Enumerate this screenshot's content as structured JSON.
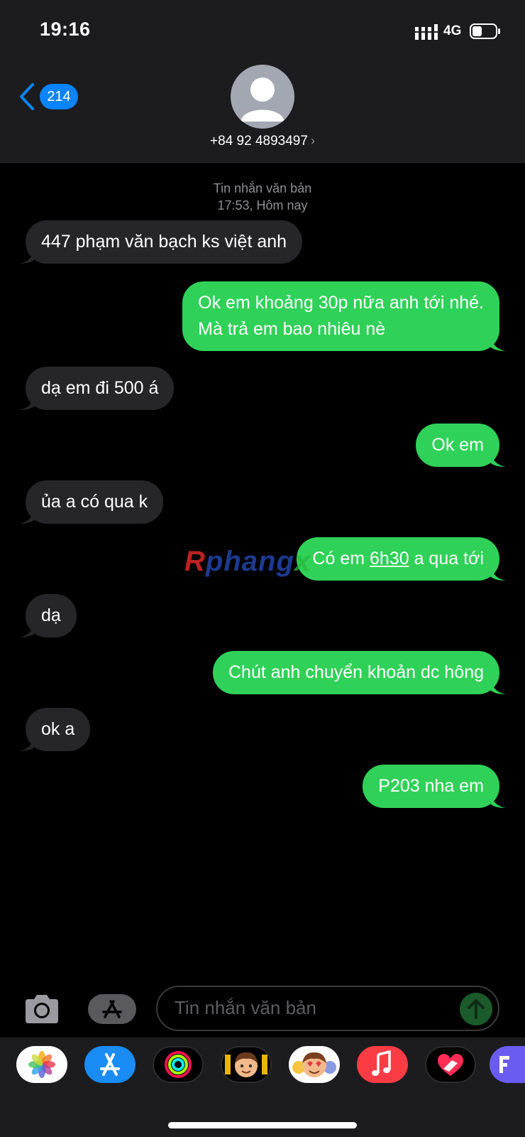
{
  "status_bar": {
    "time": "19:16",
    "network": "4G"
  },
  "nav": {
    "back_count": "214",
    "contact": "+84 92 4893497"
  },
  "conversation": {
    "type_label": "Tin nhắn văn bản",
    "time_label": "17:53, Hôm nay",
    "messages": [
      {
        "dir": "in",
        "lines": [
          "447 phạm văn bạch ks việt anh"
        ]
      },
      {
        "dir": "out",
        "lines": [
          "Ok em khoảng 30p nữa anh tới nhé.",
          "Mà trả em bao nhiêu nè"
        ]
      },
      {
        "dir": "in",
        "lines": [
          "dạ em đi 500 á"
        ]
      },
      {
        "dir": "out",
        "lines": [
          "Ok em"
        ]
      },
      {
        "dir": "in",
        "lines": [
          "ủa a có qua k"
        ]
      },
      {
        "dir": "out",
        "parts": [
          "Có em ",
          "6h30",
          " a qua tới"
        ]
      },
      {
        "dir": "in",
        "lines": [
          "dạ"
        ]
      },
      {
        "dir": "out",
        "lines": [
          "Chút anh chuyển khoản dc hông"
        ]
      },
      {
        "dir": "in",
        "lines": [
          "ok a"
        ]
      },
      {
        "dir": "out",
        "lines": [
          "P203 nha em"
        ]
      }
    ]
  },
  "watermark": {
    "part1": "R",
    "part2": "phang",
    "part3": "x"
  },
  "input": {
    "placeholder": "Tin nhắn văn bản"
  },
  "drawer": {
    "apps": [
      "photos-icon",
      "app-store-icon",
      "activity-icon",
      "memoji-icon",
      "animoji-icon",
      "music-icon",
      "digital-touch-icon",
      "more-app-icon"
    ]
  },
  "colors": {
    "incoming": "#262628",
    "outgoing": "#30d158",
    "accent": "#0a84ff"
  }
}
